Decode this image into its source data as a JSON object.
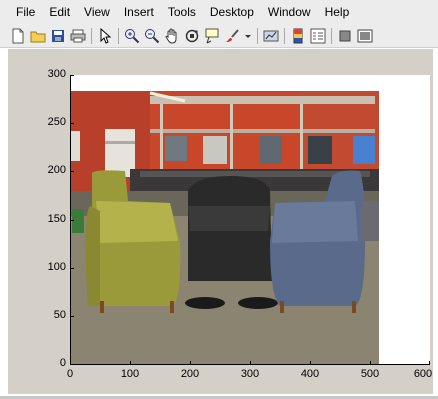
{
  "menu": [
    "File",
    "Edit",
    "View",
    "Insert",
    "Tools",
    "Desktop",
    "Window",
    "Help"
  ],
  "toolbar_icons": [
    "new-figure-icon",
    "open-file-icon",
    "save-icon",
    "print-icon",
    "edit-plot-arrow-icon",
    "zoom-in-icon",
    "zoom-out-icon",
    "pan-hand-icon",
    "rotate-3d-icon",
    "data-cursor-icon",
    "brush-icon",
    "brush-dropdown-icon",
    "link-plot-icon",
    "insert-colorbar-icon",
    "insert-legend-icon",
    "hide-plot-tools-icon",
    "show-plot-tools-icon"
  ],
  "axes": {
    "x_ticks": [
      "0",
      "100",
      "200",
      "300",
      "400",
      "500",
      "600"
    ],
    "y_ticks": [
      "0",
      "50",
      "100",
      "150",
      "200",
      "250",
      "300"
    ],
    "xlim": [
      0,
      600
    ],
    "ylim": [
      0,
      300
    ]
  },
  "image": {
    "description_name": "lab-room-with-chairs",
    "extent_x": [
      0,
      512
    ],
    "extent_y": [
      0,
      284
    ]
  },
  "colors": {
    "wall": "#c8472a",
    "chair_yellow": "#9a9a3a",
    "chair_black": "#2a2a2a",
    "chair_blue": "#5a6a8a",
    "carpet": "#8a8470"
  }
}
